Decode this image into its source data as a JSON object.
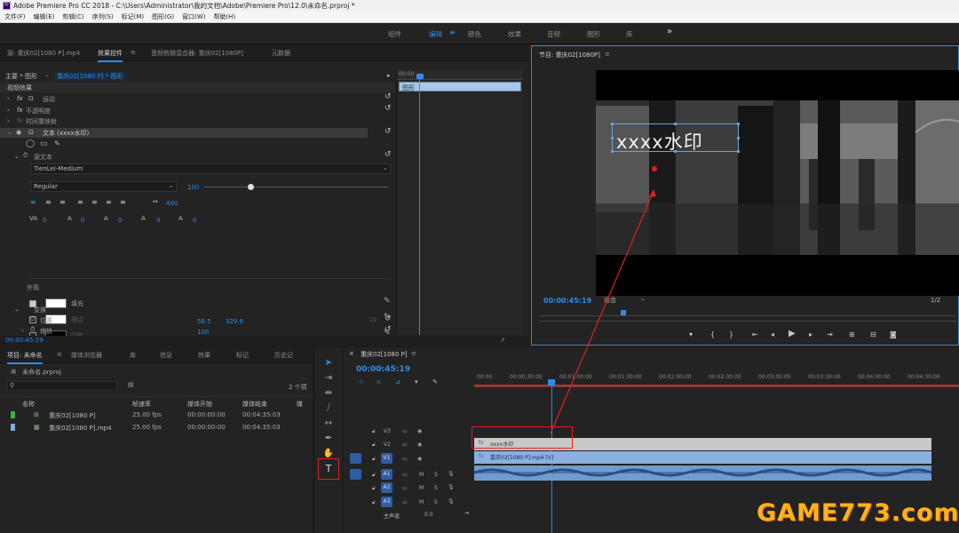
{
  "titlebar": {
    "app_icon": "premiere-icon",
    "title": "Adobe Premiere Pro CC 2018 - C:\\Users\\Administrator\\我的文档\\Adobe\\Premiere Pro\\12.0\\未命名.prproj *"
  },
  "menu": [
    "文件(F)",
    "编辑(E)",
    "剪辑(C)",
    "序列(S)",
    "标记(M)",
    "图形(G)",
    "窗口(W)",
    "帮助(H)"
  ],
  "workspaces": {
    "items": [
      "组件",
      "编辑",
      "颜色",
      "效果",
      "音频",
      "图形",
      "库"
    ],
    "active": "编辑",
    "more": "»"
  },
  "source_panel": {
    "tabs": [
      "源: 重庆02[1080 P].mp4",
      "效果控件",
      "音频剪辑混合器: 重庆02[1080P]",
      "元数据"
    ],
    "active_tab": "效果控件",
    "clip_master": "主要 * 图形",
    "clip_instance": "重庆02[1080 P] * 图形",
    "section_video": "视频效果",
    "effects": [
      "运动",
      "不透明度",
      "时间重映射"
    ],
    "text_layer": "文本 (xxxx水印)",
    "source_text_label": "源文本",
    "font_name": "TienLei-Medium",
    "font_style": "Regular",
    "font_size": "100",
    "tracking": "400",
    "kerning_vals": [
      "0",
      "0",
      "0",
      "0",
      "0"
    ],
    "appearance_label": "外观",
    "fill_label": "填充",
    "stroke_label": "描边",
    "shadow_label": "阴影",
    "stroke_width": "10",
    "transform_label": "变换",
    "position_label": "位置",
    "position_x": "58.5",
    "position_y": "329.6",
    "scale_label": "缩放",
    "scale_val": "100",
    "timecode": "00:00:45:19",
    "mini_timeline_clip": "图形"
  },
  "program_monitor": {
    "title": "节目: 重庆02[1080P]",
    "overlay_text": "xxxx水印",
    "timecode": "00:00:45:19",
    "fit": "适合",
    "resolution": "1/2"
  },
  "project_panel": {
    "tabs": [
      "项目: 未命名",
      "媒体浏览器",
      "库",
      "信息",
      "效果",
      "标记",
      "历史记"
    ],
    "active_tab": "项目: 未命名",
    "file": "未命名.prproj",
    "count": "2 个项",
    "columns": [
      "名称",
      "帧速率",
      "媒体开始",
      "媒体结束",
      "媒"
    ],
    "rows": [
      {
        "color": "#3fae49",
        "name": "重庆02[1080 P]",
        "fps": "25.00 fps",
        "start": "00:00:00:00",
        "end": "00:04:35:03"
      },
      {
        "color": "#7fa7e0",
        "name": "重庆02[1080 P].mp4",
        "fps": "25.00 fps",
        "start": "00:00:00:00",
        "end": "00:04:35:03"
      }
    ]
  },
  "timeline": {
    "tab": "重庆02[1080 P]",
    "timecode": "00:00:45:19",
    "ruler": [
      "00:00",
      "00:00:30:00",
      "00:01:00:00",
      "00:01:30:00",
      "00:02:00:00",
      "00:02:30:00",
      "00:03:00:00",
      "00:03:30:00",
      "00:04:00:00",
      "00:04:30:00"
    ],
    "tracks": [
      "V3",
      "V2",
      "V1",
      "A1",
      "A2",
      "A3"
    ],
    "master": "主声道",
    "master_val": "0.0",
    "graphic_clip": "xxxx水印",
    "video_clip": "重庆02[1080 P].mp4 [V]"
  },
  "watermark": "GAME773.com",
  "colors": {
    "accent": "#2d8ceb",
    "highlight": "#e02020"
  }
}
